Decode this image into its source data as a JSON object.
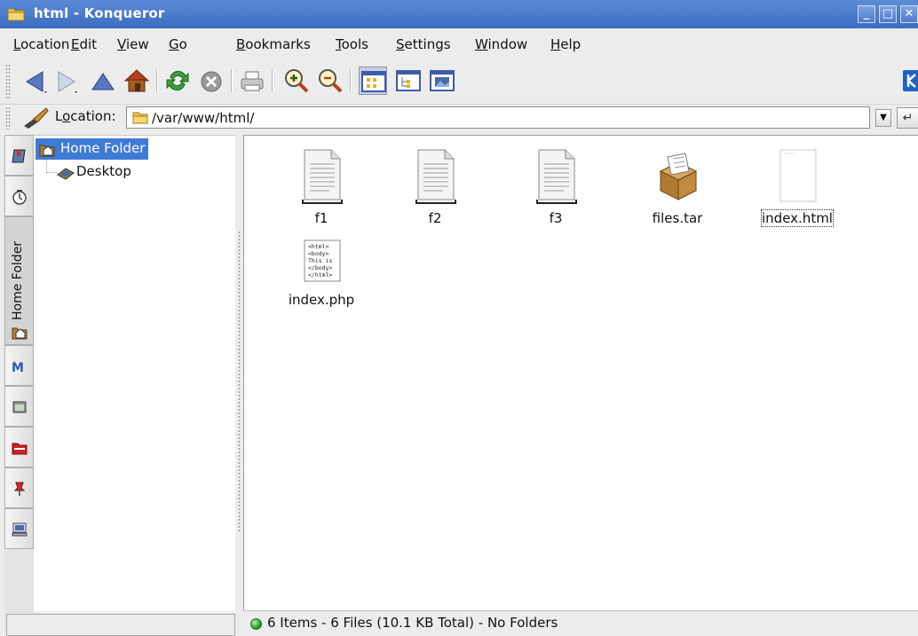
{
  "window": {
    "title": "html - Konqueror",
    "minimize": "_",
    "maximize": "□",
    "close": "✕"
  },
  "menu": [
    {
      "label": "Location",
      "key": "L",
      "rest": "ocation"
    },
    {
      "label": "Edit",
      "key": "E",
      "rest": "dit"
    },
    {
      "label": "View",
      "key": "V",
      "rest": "iew"
    },
    {
      "label": "Go",
      "key": "G",
      "rest": "o"
    },
    {
      "label": "Bookmarks",
      "key": "B",
      "rest": "ookmarks"
    },
    {
      "label": "Tools",
      "key": "T",
      "rest": "ools"
    },
    {
      "label": "Settings",
      "key": "S",
      "rest": "ettings"
    },
    {
      "label": "Window",
      "key": "W",
      "rest": "indow"
    },
    {
      "label": "Help",
      "key": "H",
      "rest": "elp"
    }
  ],
  "toolbar": {
    "icons": [
      "back-icon",
      "forward-icon",
      "up-icon",
      "home-icon",
      "reload-icon",
      "stop-icon",
      "print-icon",
      "zoom-in-icon",
      "zoom-out-icon",
      "icon-view-icon",
      "tree-view-icon",
      "image-view-icon",
      "kde-logo-icon"
    ]
  },
  "location": {
    "label_pre": "L",
    "label_key": "o",
    "label_post": "cation:",
    "value": "/var/www/html/"
  },
  "sidebar": {
    "tab_label": "Home Folder",
    "tree": {
      "root": "Home Folder",
      "child": "Desktop"
    }
  },
  "files": [
    {
      "name": "f1",
      "type": "text"
    },
    {
      "name": "f2",
      "type": "text"
    },
    {
      "name": "f3",
      "type": "text"
    },
    {
      "name": "files.tar",
      "type": "archive"
    },
    {
      "name": "index.html",
      "type": "html"
    },
    {
      "name": "index.php",
      "type": "php",
      "preview": [
        "<html>",
        "<body>",
        "This is",
        "</body>",
        "</html>"
      ]
    }
  ],
  "status": {
    "text": "6 Items - 6 Files (10.1 KB Total) - No Folders"
  },
  "colors": {
    "titlebar": "#4a7ccb",
    "selection": "#3f7bd6",
    "status_led": "#28a028"
  }
}
